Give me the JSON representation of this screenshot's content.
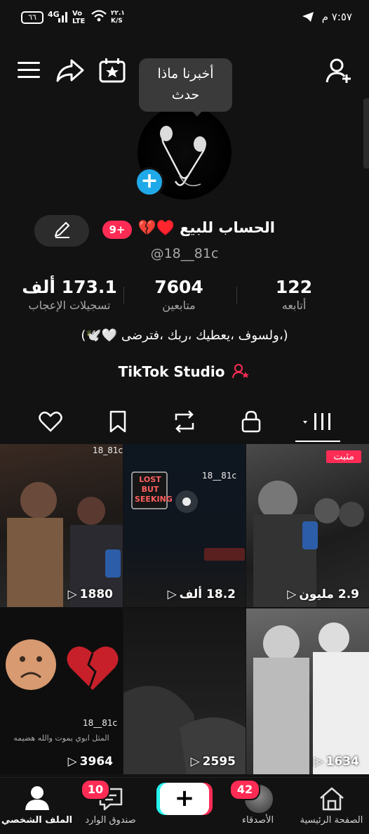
{
  "status_bar": {
    "time": "٧:٥٧ م",
    "battery": "٦٦",
    "network": "4G",
    "volte_top": "Vo",
    "volte_bottom": "LTE",
    "speed_value": "٢٢.١",
    "speed_unit": "K/S"
  },
  "top_bar": {
    "icons": [
      "menu-icon",
      "share-icon",
      "calendar-star-icon",
      "add-user-icon"
    ],
    "tooltip_line1": "أخبرنا ماذا",
    "tooltip_line2": "حدث"
  },
  "profile": {
    "name": "الحساب للبيع ♥️💔",
    "badge": "9+",
    "handle": "@18__81c",
    "bio": "(،ولسوف ،يعطيك ،ربك ،فترضى 🤍🕊️)",
    "studio_label": "TikTok Studio"
  },
  "stats": [
    {
      "num": "122",
      "label": "أتابعه"
    },
    {
      "num": "7604",
      "label": "متابعين"
    },
    {
      "num": "173.1 ألف",
      "label": "تسجيلات الإعجاب"
    }
  ],
  "tabs": [
    "videos-grid-icon",
    "lock-icon",
    "repost-icon",
    "bookmark-icon",
    "heart-icon"
  ],
  "videos": [
    {
      "views": "2.9 مليون",
      "pinned": "مثبت",
      "watermark": ""
    },
    {
      "views": "18.2 ألف",
      "pinned": "",
      "watermark": "18__81c",
      "sign": "LOST BUT SEEKING"
    },
    {
      "views": "1880",
      "pinned": "",
      "watermark": "18_81c"
    },
    {
      "views": "1634",
      "pinned": "",
      "watermark": ""
    },
    {
      "views": "2595",
      "pinned": "",
      "watermark": ""
    },
    {
      "views": "3964",
      "pinned": "",
      "watermark": "18__81c",
      "caption": "المثل ابوي يموت والله هضيمه"
    }
  ],
  "nav": {
    "home": "الصفحة الرئيسية",
    "friends": "الأصدقاء",
    "friends_badge": "42",
    "create": "+",
    "inbox": "صندوق الوارد",
    "inbox_badge": "10",
    "profile": "الملف الشخصي"
  },
  "colors": {
    "accent": "#fe2c55",
    "background": "#121212",
    "avatar_plus": "#20a9e8",
    "muted_text": "#a8a8a8"
  }
}
